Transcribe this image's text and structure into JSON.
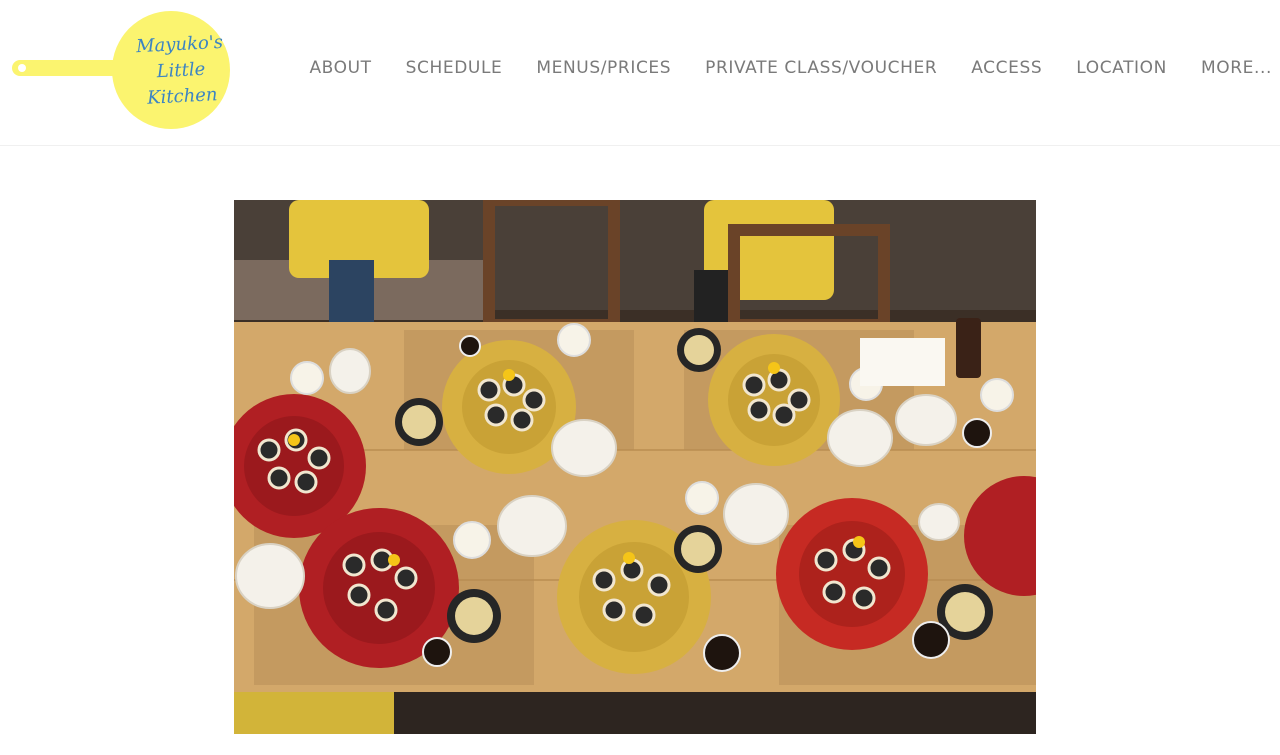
{
  "logo": {
    "lines": [
      "Mayuko's",
      "Little",
      "Kitchen"
    ],
    "badge_color": "#fbf46f",
    "text_color": "#3c84c3"
  },
  "nav": {
    "items": [
      {
        "label": "ABOUT"
      },
      {
        "label": "SCHEDULE"
      },
      {
        "label": "MENUS/PRICES"
      },
      {
        "label": "PRIVATE CLASS/VOUCHER"
      },
      {
        "label": "ACCESS"
      },
      {
        "label": "LOCATION"
      },
      {
        "label": "MORE..."
      }
    ],
    "text_color": "#7a7a7a"
  },
  "hero": {
    "subject": "overhead-photo-sushi-rolls-table"
  }
}
